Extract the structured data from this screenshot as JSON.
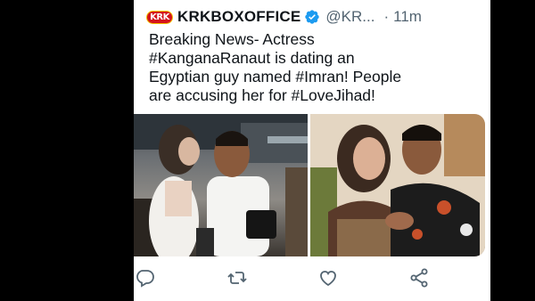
{
  "tweet": {
    "avatar_text": "KRK",
    "display_name": "KRKBOXOFFICE",
    "handle": "@KR...",
    "separator": "·",
    "time": "11m",
    "text": "Breaking News- Actress\n#KanganaRanaut is dating an\nEgyptian guy named #Imran! People\nare accusing her for #LoveJihad!"
  },
  "actions": {
    "icons": [
      "reply-icon",
      "retweet-icon",
      "like-icon",
      "share-icon"
    ]
  },
  "colors": {
    "background": "#000000",
    "card": "#ffffff",
    "text": "#0f1419",
    "secondary": "#536471",
    "verified": "#1d9bf0"
  }
}
